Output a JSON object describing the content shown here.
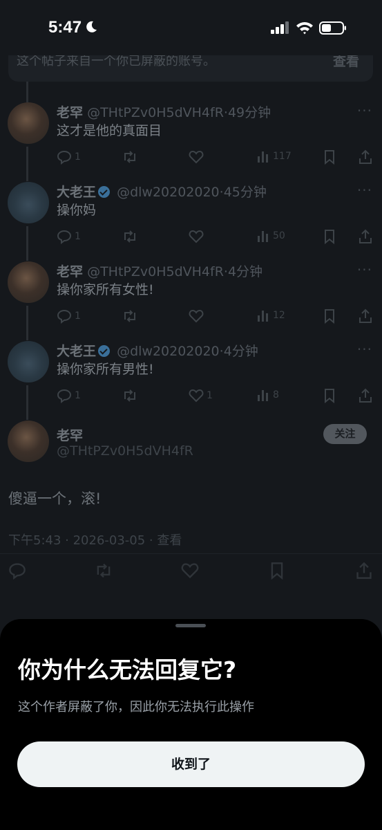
{
  "status_bar": {
    "time": "5:47"
  },
  "blocked_banner": {
    "text": "这个帖子来自一个你已屏蔽的账号。",
    "view": "查看"
  },
  "tweets": [
    {
      "name": "老罕",
      "verified": false,
      "handle": "@THtPZv0H5dVH4fR",
      "time": "·49分钟",
      "text": "这才是他的真面目",
      "replies": "1",
      "retweets": "",
      "likes": "",
      "views": "117"
    },
    {
      "name": "大老王",
      "verified": true,
      "handle": "@dlw20202020",
      "time": "·45分钟",
      "text": "操你妈",
      "replies": "1",
      "retweets": "",
      "likes": "",
      "views": "50"
    },
    {
      "name": "老罕",
      "verified": false,
      "handle": "@THtPZv0H5dVH4fR",
      "time": "·4分钟",
      "text": "操你家所有女性!",
      "replies": "1",
      "retweets": "",
      "likes": "",
      "views": "12"
    },
    {
      "name": "大老王",
      "verified": true,
      "handle": "@dlw20202020",
      "time": "·4分钟",
      "text": "操你家所有男性!",
      "replies": "1",
      "retweets": "",
      "likes": "1",
      "views": "8"
    }
  ],
  "focus": {
    "name": "老罕",
    "handle": "@THtPZv0H5dVH4fR",
    "follow_label": "关注",
    "text": "傻逼一个，滚!",
    "meta": "下午5:43 · 2026-03-05 · 查看"
  },
  "sheet": {
    "title": "你为什么无法回复它?",
    "subtitle": "这个作者屏蔽了你，因此你无法执行此操作",
    "button": "收到了"
  },
  "icons": [
    "moon-icon",
    "signal-icon",
    "wifi-icon",
    "battery-icon",
    "reply-icon",
    "retweet-icon",
    "like-icon",
    "views-icon",
    "bookmark-icon",
    "share-icon",
    "more-icon",
    "verified-icon"
  ]
}
